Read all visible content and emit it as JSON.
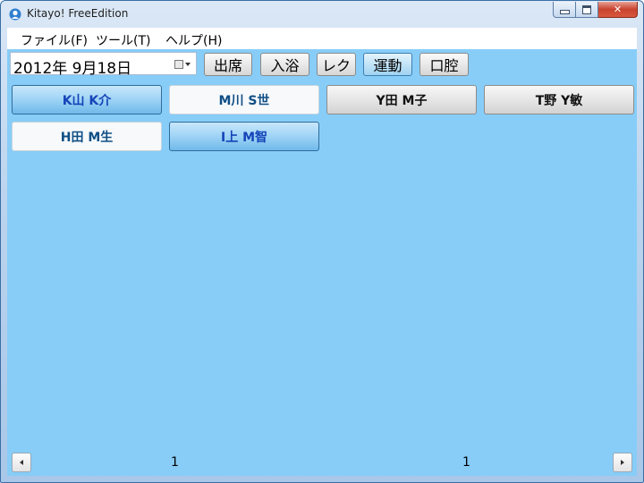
{
  "window": {
    "title": "Kitayo! FreeEdition"
  },
  "menu": [
    "ファイル(F)",
    "ツール(T)",
    "ヘルプ(H)"
  ],
  "toolbar": {
    "date_value": "2012年  9月18日",
    "buttons": [
      {
        "label": "出席",
        "active": false
      },
      {
        "label": "入浴",
        "active": false
      },
      {
        "label": "レク",
        "active": false
      },
      {
        "label": "運動",
        "active": true
      },
      {
        "label": "口腔",
        "active": false
      }
    ]
  },
  "persons": [
    {
      "name": "K山 K介",
      "state": "selected"
    },
    {
      "name": "M川 S世",
      "state": "white"
    },
    {
      "name": "Y田 M子",
      "state": "gray"
    },
    {
      "name": "T野 Y敏",
      "state": "gray"
    },
    {
      "name": "H田 M生",
      "state": "white"
    },
    {
      "name": "I上 M智",
      "state": "selected"
    }
  ],
  "pager": {
    "left_page": "1",
    "right_page": "1"
  },
  "colors": {
    "client_bg": "#87cdf8",
    "selected_text": "#1544b8",
    "close_button": "#c8432e"
  }
}
